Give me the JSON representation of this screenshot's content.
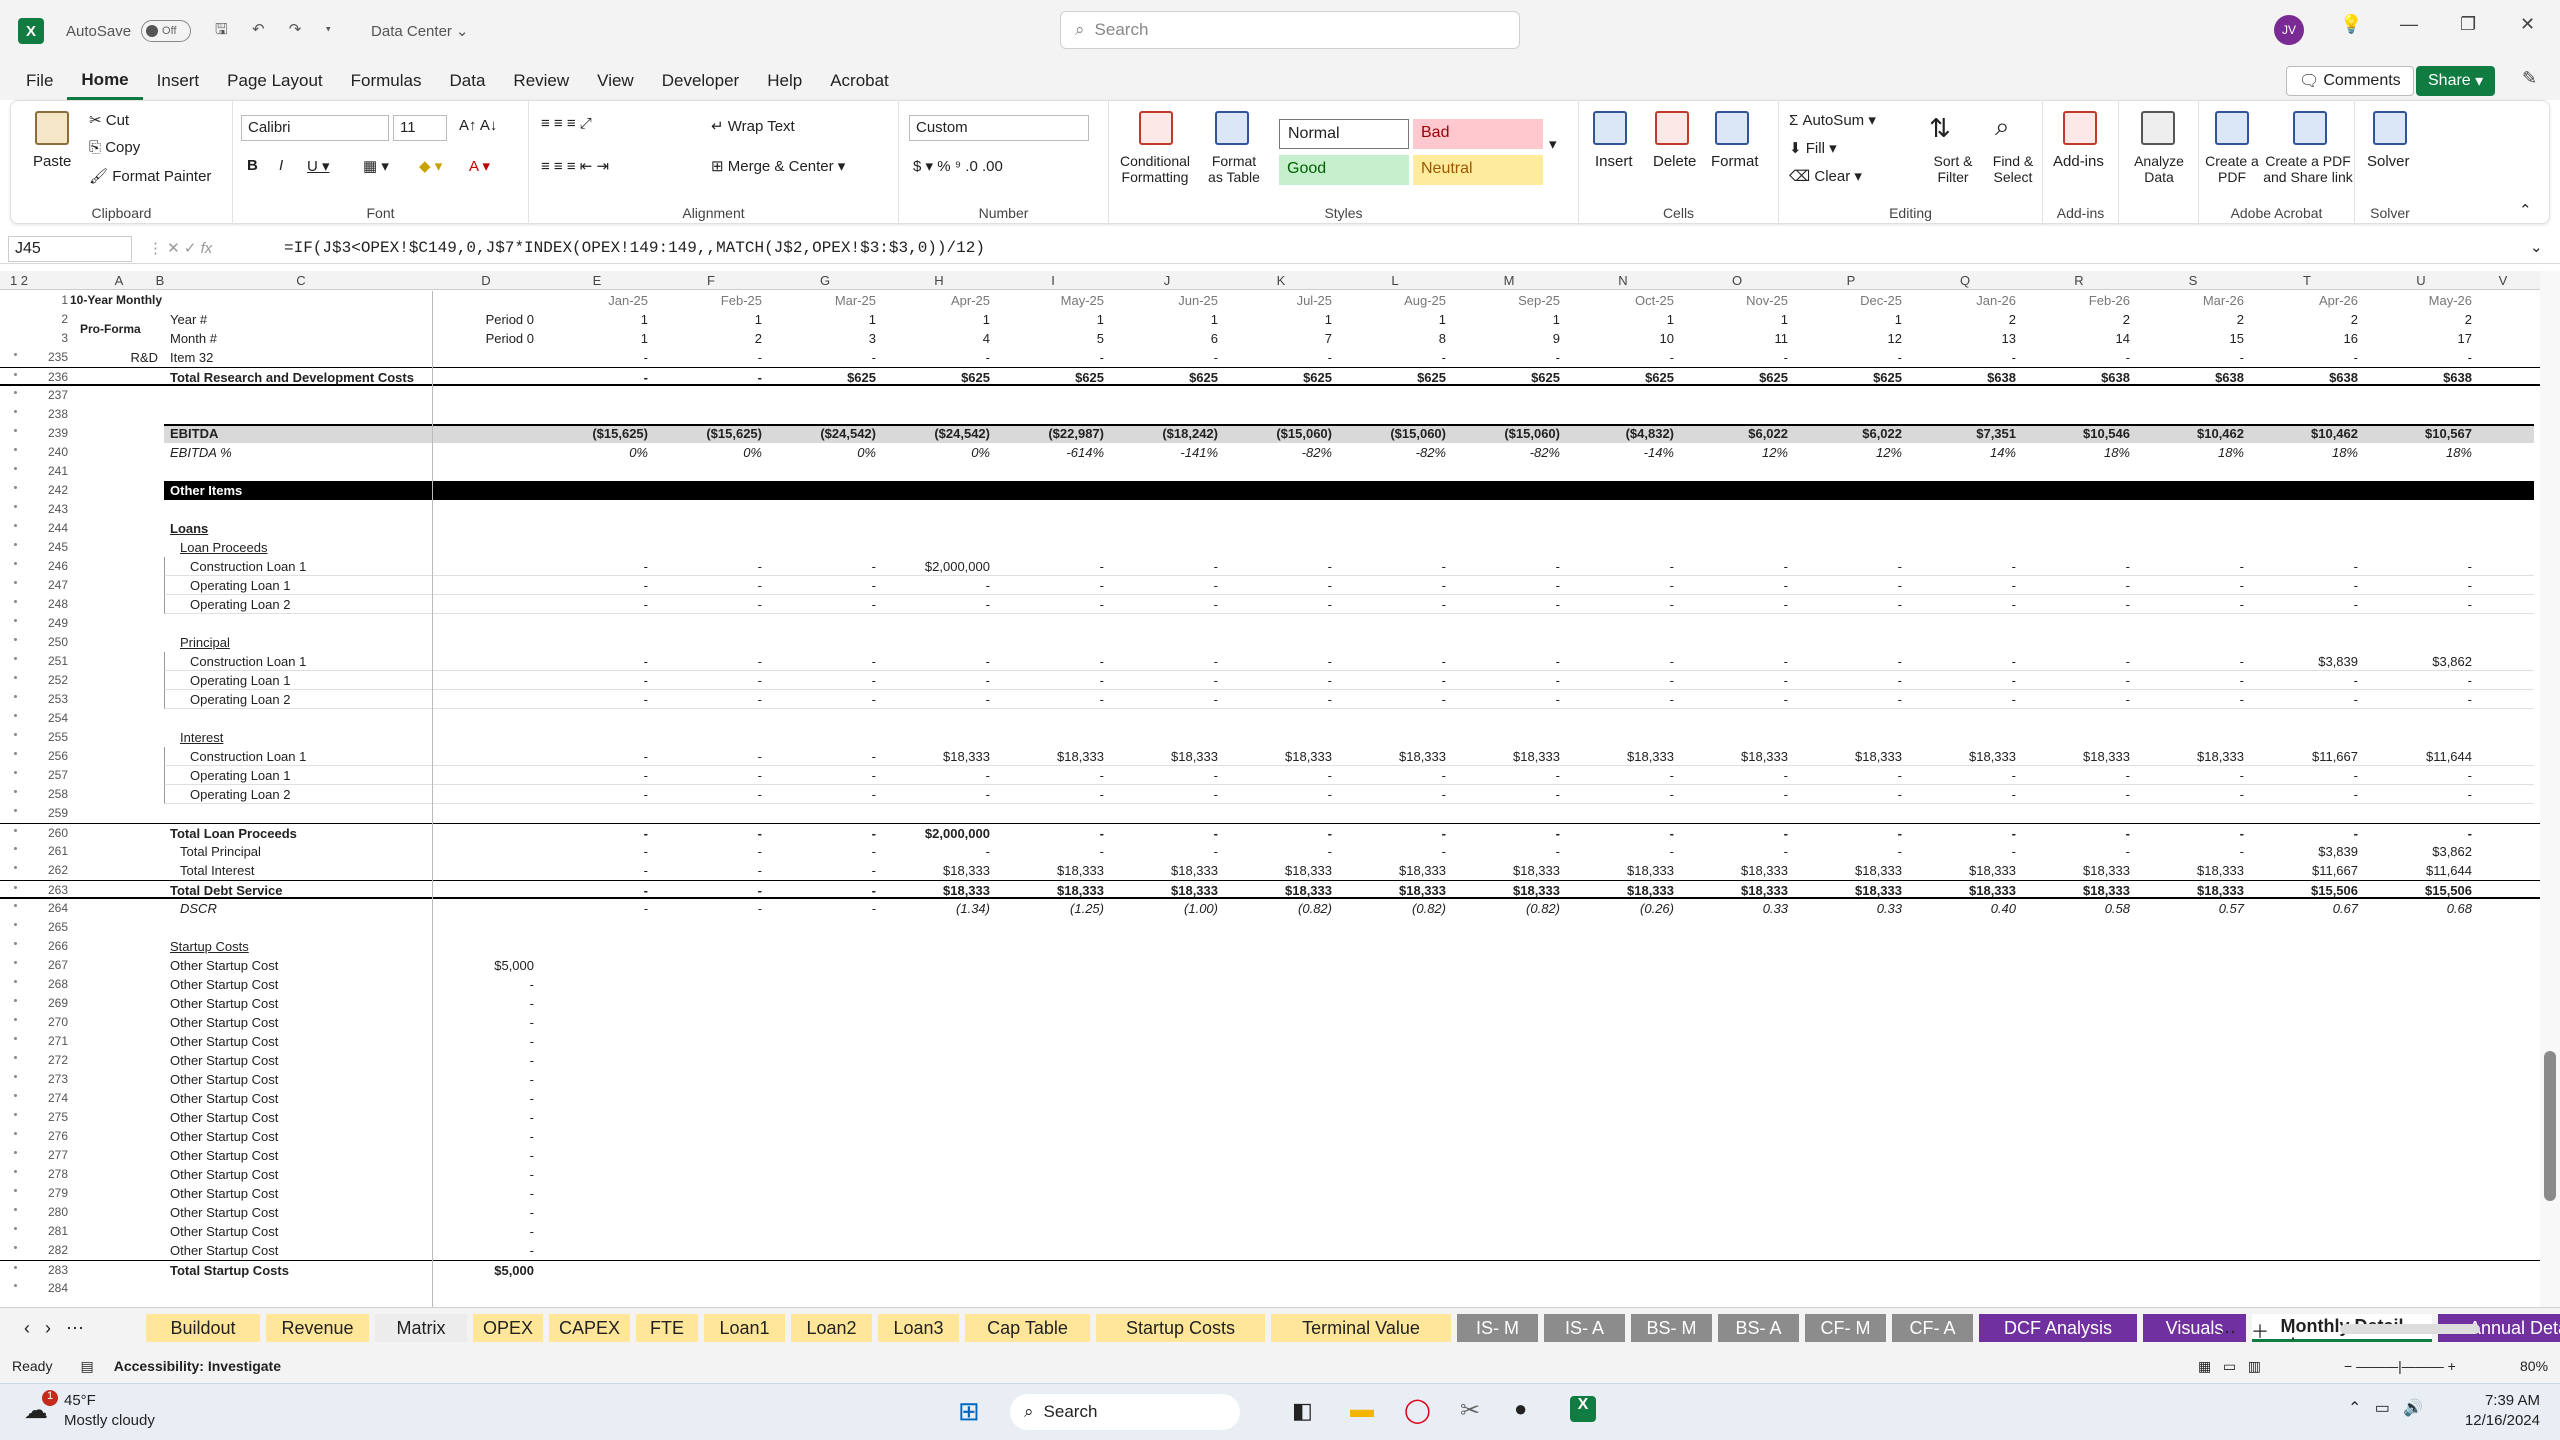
{
  "titlebar": {
    "autosave_label": "AutoSave",
    "autosave_state": "Off",
    "doc_title": "Data Center",
    "search_placeholder": "Search",
    "avatar_initials": "JV"
  },
  "menu": [
    "File",
    "Home",
    "Insert",
    "Page Layout",
    "Formulas",
    "Data",
    "Review",
    "View",
    "Developer",
    "Help",
    "Acrobat"
  ],
  "menu_active": "Home",
  "comments_label": "Comments",
  "share_label": "Share",
  "ribbon": {
    "clipboard": {
      "paste": "Paste",
      "cut": "Cut",
      "copy": "Copy",
      "format_painter": "Format Painter",
      "label": "Clipboard"
    },
    "font": {
      "name": "Calibri",
      "size": "11",
      "label": "Font"
    },
    "alignment": {
      "wrap": "Wrap Text",
      "merge": "Merge & Center",
      "label": "Alignment"
    },
    "number": {
      "format": "Custom",
      "label": "Number"
    },
    "styles": {
      "conditional": "Conditional Formatting",
      "format_table": "Format as Table",
      "normal": "Normal",
      "bad": "Bad",
      "good": "Good",
      "neutral": "Neutral",
      "label": "Styles"
    },
    "cells": {
      "insert": "Insert",
      "delete": "Delete",
      "format": "Format",
      "label": "Cells"
    },
    "editing": {
      "autosum": "AutoSum",
      "fill": "Fill",
      "clear": "Clear",
      "sort": "Sort & Filter",
      "find": "Find & Select",
      "label": "Editing"
    },
    "addins": {
      "addins": "Add-ins",
      "label": "Add-ins"
    },
    "analyze": {
      "label": "Analyze Data"
    },
    "acrobat": {
      "create_pdf": "Create a PDF",
      "create_share": "Create a PDF and Share link",
      "label": "Adobe Acrobat"
    },
    "solver": {
      "solver": "Solver",
      "label": "Solver"
    }
  },
  "namebox": "J45",
  "formula": "=IF(J$3<OPEX!$C149,0,J$7*INDEX(OPEX!149:149,,MATCH(J$2,OPEX!$3:$3,0))/12)",
  "columns": [
    "A",
    "B",
    "C",
    "D",
    "E",
    "F",
    "G",
    "H",
    "I",
    "J",
    "K",
    "L",
    "M",
    "N",
    "O",
    "P",
    "Q",
    "R",
    "S",
    "T",
    "U",
    "V"
  ],
  "header_rows": {
    "title1": "10-Year Monthly",
    "title2": "Pro-Forma",
    "months": [
      "Jan-25",
      "Feb-25",
      "Mar-25",
      "Apr-25",
      "May-25",
      "Jun-25",
      "Jul-25",
      "Aug-25",
      "Sep-25",
      "Oct-25",
      "Nov-25",
      "Dec-25",
      "Jan-26",
      "Feb-26",
      "Mar-26",
      "Apr-26",
      "May-26"
    ],
    "year_label": "Year #",
    "year_p0": "Period 0",
    "years": [
      "1",
      "1",
      "1",
      "1",
      "1",
      "1",
      "1",
      "1",
      "1",
      "1",
      "1",
      "1",
      "2",
      "2",
      "2",
      "2",
      "2"
    ],
    "month_label": "Month #",
    "month_p0": "Period 0",
    "month_nums": [
      "1",
      "2",
      "3",
      "4",
      "5",
      "6",
      "7",
      "8",
      "9",
      "10",
      "11",
      "12",
      "13",
      "14",
      "15",
      "16",
      "17"
    ]
  },
  "rows": [
    {
      "n": "235",
      "b": "R&D",
      "c": "Item 32",
      "v": [
        "-",
        "-",
        "-",
        "-",
        "-",
        "-",
        "-",
        "-",
        "-",
        "-",
        "-",
        "-",
        "-",
        "-",
        "-",
        "-",
        "-"
      ]
    },
    {
      "n": "236",
      "c": "Total Research and Development Costs",
      "cls": "bold",
      "v": [
        "-",
        "-",
        "$625",
        "$625",
        "$625",
        "$625",
        "$625",
        "$625",
        "$625",
        "$625",
        "$625",
        "$625",
        "$638",
        "$638",
        "$638",
        "$638",
        "$638"
      ]
    },
    {
      "n": "237"
    },
    {
      "n": "238"
    },
    {
      "n": "239",
      "c": "EBITDA",
      "cls": "bold",
      "v": [
        "($15,625)",
        "($15,625)",
        "($24,542)",
        "($24,542)",
        "($22,987)",
        "($18,242)",
        "($15,060)",
        "($15,060)",
        "($15,060)",
        "($4,832)",
        "$6,022",
        "$6,022",
        "$7,351",
        "$10,546",
        "$10,462",
        "$10,462",
        "$10,567"
      ]
    },
    {
      "n": "240",
      "c": "EBITDA %",
      "cls": "it",
      "v": [
        "0%",
        "0%",
        "0%",
        "0%",
        "-614%",
        "-141%",
        "-82%",
        "-82%",
        "-82%",
        "-14%",
        "12%",
        "12%",
        "14%",
        "18%",
        "18%",
        "18%",
        "18%"
      ]
    },
    {
      "n": "241"
    },
    {
      "n": "242",
      "c": "Other Items",
      "cls": "bold"
    },
    {
      "n": "243"
    },
    {
      "n": "244",
      "c": "Loans",
      "cls": "bold ul"
    },
    {
      "n": "245",
      "c": "Loan Proceeds",
      "cls": "ul",
      "ind": 1
    },
    {
      "n": "246",
      "c": "Construction Loan 1",
      "ind": 2,
      "v": [
        "-",
        "-",
        "-",
        "$2,000,000",
        "-",
        "-",
        "-",
        "-",
        "-",
        "-",
        "-",
        "-",
        "-",
        "-",
        "-",
        "-",
        "-"
      ]
    },
    {
      "n": "247",
      "c": "Operating Loan 1",
      "ind": 2,
      "v": [
        "-",
        "-",
        "-",
        "-",
        "-",
        "-",
        "-",
        "-",
        "-",
        "-",
        "-",
        "-",
        "-",
        "-",
        "-",
        "-",
        "-"
      ]
    },
    {
      "n": "248",
      "c": "Operating Loan 2",
      "ind": 2,
      "v": [
        "-",
        "-",
        "-",
        "-",
        "-",
        "-",
        "-",
        "-",
        "-",
        "-",
        "-",
        "-",
        "-",
        "-",
        "-",
        "-",
        "-"
      ]
    },
    {
      "n": "249"
    },
    {
      "n": "250",
      "c": "Principal",
      "cls": "ul",
      "ind": 1
    },
    {
      "n": "251",
      "c": "Construction Loan 1",
      "ind": 2,
      "v": [
        "-",
        "-",
        "-",
        "-",
        "-",
        "-",
        "-",
        "-",
        "-",
        "-",
        "-",
        "-",
        "-",
        "-",
        "-",
        "$3,839",
        "$3,862"
      ]
    },
    {
      "n": "252",
      "c": "Operating Loan 1",
      "ind": 2,
      "v": [
        "-",
        "-",
        "-",
        "-",
        "-",
        "-",
        "-",
        "-",
        "-",
        "-",
        "-",
        "-",
        "-",
        "-",
        "-",
        "-",
        "-"
      ]
    },
    {
      "n": "253",
      "c": "Operating Loan 2",
      "ind": 2,
      "v": [
        "-",
        "-",
        "-",
        "-",
        "-",
        "-",
        "-",
        "-",
        "-",
        "-",
        "-",
        "-",
        "-",
        "-",
        "-",
        "-",
        "-"
      ]
    },
    {
      "n": "254"
    },
    {
      "n": "255",
      "c": "Interest",
      "cls": "ul",
      "ind": 1
    },
    {
      "n": "256",
      "c": "Construction Loan 1",
      "ind": 2,
      "v": [
        "-",
        "-",
        "-",
        "$18,333",
        "$18,333",
        "$18,333",
        "$18,333",
        "$18,333",
        "$18,333",
        "$18,333",
        "$18,333",
        "$18,333",
        "$18,333",
        "$18,333",
        "$18,333",
        "$11,667",
        "$11,644"
      ]
    },
    {
      "n": "257",
      "c": "Operating Loan 1",
      "ind": 2,
      "v": [
        "-",
        "-",
        "-",
        "-",
        "-",
        "-",
        "-",
        "-",
        "-",
        "-",
        "-",
        "-",
        "-",
        "-",
        "-",
        "-",
        "-"
      ]
    },
    {
      "n": "258",
      "c": "Operating Loan 2",
      "ind": 2,
      "v": [
        "-",
        "-",
        "-",
        "-",
        "-",
        "-",
        "-",
        "-",
        "-",
        "-",
        "-",
        "-",
        "-",
        "-",
        "-",
        "-",
        "-"
      ]
    },
    {
      "n": "259"
    },
    {
      "n": "260",
      "c": "Total Loan Proceeds",
      "cls": "bold",
      "v": [
        "-",
        "-",
        "-",
        "$2,000,000",
        "-",
        "-",
        "-",
        "-",
        "-",
        "-",
        "-",
        "-",
        "-",
        "-",
        "-",
        "-",
        "-"
      ]
    },
    {
      "n": "261",
      "c": "Total Principal",
      "ind": 1,
      "v": [
        "-",
        "-",
        "-",
        "-",
        "-",
        "-",
        "-",
        "-",
        "-",
        "-",
        "-",
        "-",
        "-",
        "-",
        "-",
        "$3,839",
        "$3,862"
      ]
    },
    {
      "n": "262",
      "c": "Total Interest",
      "ind": 1,
      "v": [
        "-",
        "-",
        "-",
        "$18,333",
        "$18,333",
        "$18,333",
        "$18,333",
        "$18,333",
        "$18,333",
        "$18,333",
        "$18,333",
        "$18,333",
        "$18,333",
        "$18,333",
        "$18,333",
        "$11,667",
        "$11,644"
      ]
    },
    {
      "n": "263",
      "c": "Total Debt Service",
      "cls": "bold",
      "v": [
        "-",
        "-",
        "-",
        "$18,333",
        "$18,333",
        "$18,333",
        "$18,333",
        "$18,333",
        "$18,333",
        "$18,333",
        "$18,333",
        "$18,333",
        "$18,333",
        "$18,333",
        "$18,333",
        "$15,506",
        "$15,506"
      ]
    },
    {
      "n": "264",
      "c": "DSCR",
      "cls": "it",
      "ind": 1,
      "v": [
        "-",
        "-",
        "-",
        "(1.34)",
        "(1.25)",
        "(1.00)",
        "(0.82)",
        "(0.82)",
        "(0.82)",
        "(0.26)",
        "0.33",
        "0.33",
        "0.40",
        "0.58",
        "0.57",
        "0.67",
        "0.68"
      ]
    },
    {
      "n": "265"
    },
    {
      "n": "266",
      "c": "Startup Costs",
      "cls": "ul"
    },
    {
      "n": "267",
      "c": "Other Startup Cost",
      "d": "$5,000"
    },
    {
      "n": "268",
      "c": "Other Startup Cost",
      "d": "-"
    },
    {
      "n": "269",
      "c": "Other Startup Cost",
      "d": "-"
    },
    {
      "n": "270",
      "c": "Other Startup Cost",
      "d": "-"
    },
    {
      "n": "271",
      "c": "Other Startup Cost",
      "d": "-"
    },
    {
      "n": "272",
      "c": "Other Startup Cost",
      "d": "-"
    },
    {
      "n": "273",
      "c": "Other Startup Cost",
      "d": "-"
    },
    {
      "n": "274",
      "c": "Other Startup Cost",
      "d": "-"
    },
    {
      "n": "275",
      "c": "Other Startup Cost",
      "d": "-"
    },
    {
      "n": "276",
      "c": "Other Startup Cost",
      "d": "-"
    },
    {
      "n": "277",
      "c": "Other Startup Cost",
      "d": "-"
    },
    {
      "n": "278",
      "c": "Other Startup Cost",
      "d": "-"
    },
    {
      "n": "279",
      "c": "Other Startup Cost",
      "d": "-"
    },
    {
      "n": "280",
      "c": "Other Startup Cost",
      "d": "-"
    },
    {
      "n": "281",
      "c": "Other Startup Cost",
      "d": "-"
    },
    {
      "n": "282",
      "c": "Other Startup Cost",
      "d": "-"
    },
    {
      "n": "283",
      "c": "Total Startup Costs",
      "cls": "bold",
      "d": "$5,000"
    },
    {
      "n": "284"
    }
  ],
  "sheet_tabs": [
    {
      "label": "Buildout",
      "color": "#ffe699"
    },
    {
      "label": "Revenue",
      "color": "#ffe699"
    },
    {
      "label": "Matrix",
      "color": "#ececec"
    },
    {
      "label": "OPEX",
      "color": "#ffe699"
    },
    {
      "label": "CAPEX",
      "color": "#ffe699"
    },
    {
      "label": "FTE",
      "color": "#ffe699"
    },
    {
      "label": "Loan1",
      "color": "#ffe699"
    },
    {
      "label": "Loan2",
      "color": "#ffe699"
    },
    {
      "label": "Loan3",
      "color": "#ffe699"
    },
    {
      "label": "Cap Table",
      "color": "#ffe699"
    },
    {
      "label": "Startup Costs",
      "color": "#ffe699"
    },
    {
      "label": "Terminal Value",
      "color": "#ffe699"
    },
    {
      "label": "IS- M",
      "color": "#8c8c8c"
    },
    {
      "label": "IS- A",
      "color": "#8c8c8c"
    },
    {
      "label": "BS- M",
      "color": "#8c8c8c"
    },
    {
      "label": "BS- A",
      "color": "#8c8c8c"
    },
    {
      "label": "CF- M",
      "color": "#8c8c8c"
    },
    {
      "label": "CF- A",
      "color": "#8c8c8c"
    },
    {
      "label": "DCF Analysis",
      "color": "#7030a0"
    },
    {
      "label": "Visuals",
      "color": "#7030a0"
    },
    {
      "label": "Monthly Detail",
      "color": "#ffffff"
    },
    {
      "label": "Annual Detail",
      "color": "#7030a0"
    }
  ],
  "status": {
    "ready": "Ready",
    "accessibility": "Accessibility: Investigate",
    "zoom": "80%"
  },
  "taskbar": {
    "temp": "45°F",
    "weather": "Mostly cloudy",
    "search": "Search",
    "time": "7:39 AM",
    "date": "12/16/2024",
    "badge": "1"
  }
}
